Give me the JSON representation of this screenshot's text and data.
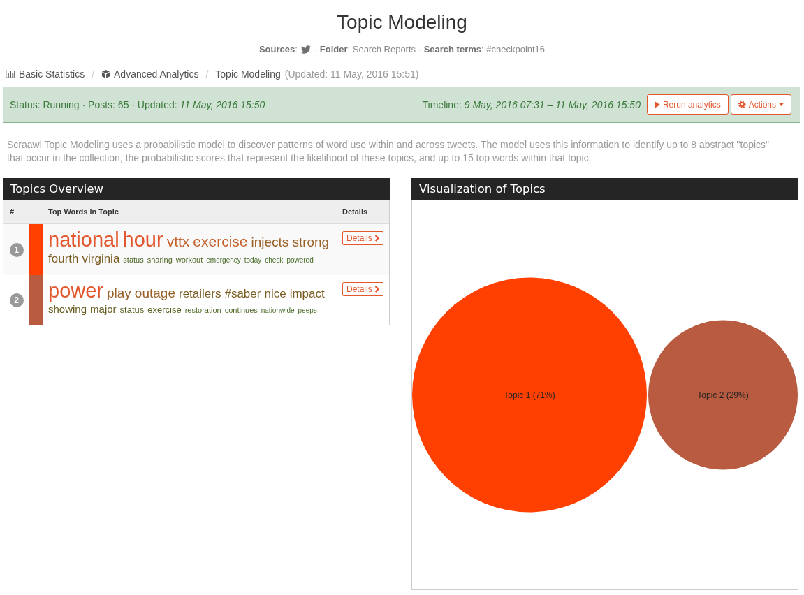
{
  "page": {
    "title": "Topic Modeling",
    "subtitle": {
      "sources": "**Sources**:",
      "details": "· **Folder**: Search Reports · **Search terms**: #checkpoint16"
    }
  },
  "breadcrumb": {
    "items": [
      {
        "kind": "statistics",
        "label": "Basic Statistics"
      },
      {
        "kind": "separator",
        "label": "/"
      },
      {
        "kind": "analytics",
        "label": "Advanced Analytics"
      },
      {
        "kind": "separator",
        "label": "/"
      },
      {
        "kind": "current",
        "label": "Topic Modeling"
      }
    ],
    "note": "(Updated: 11 May, 2016 15:51)"
  },
  "status_bar": {
    "status": "Status: Running · Posts: 65 · Updated: *11 May, 2016 15:50*",
    "timeline": "Timeline: *9 May, 2016 07:31 – 11 May, 2016 15:50*",
    "buttons": [
      {
        "kind": "rerun",
        "label": "Rerun analytics"
      },
      {
        "kind": "actions",
        "label": "Actions"
      }
    ]
  },
  "description": "Scraawl Topic Modeling uses a probabilistic model to discover patterns of word use within and across tweets. The model uses this information to identify up to 8 abstract \"topics\" that occur in the collection, the probabilistic scores that represent the likelihood of these topics, and up to 15 top words within that topic.",
  "topics_overview": {
    "title": "Topics Overview",
    "columns": [
      "#",
      "Top Words in Topic",
      "Details"
    ],
    "topics": [
      {
        "number": "1",
        "color": "#ff4000",
        "details": "Details",
        "words": [
          {
            "text": "national",
            "kind": "xxl"
          },
          {
            "text": "hour",
            "kind": "xxl"
          },
          {
            "text": "vttx",
            "kind": "xl"
          },
          {
            "text": "exercise",
            "kind": "xl"
          },
          {
            "text": "injects",
            "kind": "lg"
          },
          {
            "text": "strong",
            "kind": "lg"
          },
          {
            "text": "fourth",
            "kind": "md"
          },
          {
            "text": "virginia",
            "kind": "md"
          },
          {
            "text": "status",
            "kind": "xxs"
          },
          {
            "text": "sharing",
            "kind": "xxs"
          },
          {
            "text": "workout",
            "kind": "xxs"
          },
          {
            "text": "emergency",
            "kind": "tiny"
          },
          {
            "text": "today",
            "kind": "tiny"
          },
          {
            "text": "check",
            "kind": "tiny"
          },
          {
            "text": "powered",
            "kind": "tiny"
          }
        ]
      },
      {
        "number": "2",
        "color": "#b85b40",
        "details": "Details",
        "words": [
          {
            "text": "power",
            "kind": "xxl"
          },
          {
            "text": "play",
            "kind": "lg"
          },
          {
            "text": "outage",
            "kind": "lg"
          },
          {
            "text": "retailers",
            "kind": "md"
          },
          {
            "text": "#saber",
            "kind": "md"
          },
          {
            "text": "nice",
            "kind": "md"
          },
          {
            "text": "impact",
            "kind": "md"
          },
          {
            "text": "showing",
            "kind": "sm"
          },
          {
            "text": "major",
            "kind": "sm"
          },
          {
            "text": "status",
            "kind": "xs"
          },
          {
            "text": "exercise",
            "kind": "xs"
          },
          {
            "text": "restoration",
            "kind": "xxs"
          },
          {
            "text": "continues",
            "kind": "xxs"
          },
          {
            "text": "nationwide",
            "kind": "tiny"
          },
          {
            "text": "peeps",
            "kind": "tiny"
          }
        ]
      }
    ]
  },
  "visualization": {
    "title": "Visualization of Topics",
    "bubbles": [
      {
        "kind": "large",
        "label": "Topic 1 (71%)",
        "color": "#ff4000"
      },
      {
        "kind": "small",
        "label": "Topic 2 (29%)",
        "color": "#b85b40"
      }
    ]
  }
}
